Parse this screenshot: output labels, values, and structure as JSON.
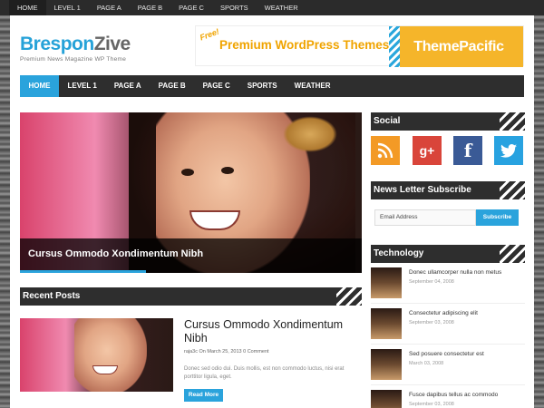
{
  "topbar": {
    "items": [
      "HOME",
      "LEVEL 1",
      "PAGE A",
      "PAGE B",
      "PAGE C",
      "SPORTS",
      "WEATHER"
    ]
  },
  "logo": {
    "title_part1": "Brespon",
    "title_part2": "Zive",
    "tagline": "Premium News Magazine WP Theme"
  },
  "ad": {
    "free": "Free!",
    "text": "Premium WordPress Themes",
    "brand": "ThemePacific"
  },
  "mainnav": {
    "items": [
      "HOME",
      "LEVEL 1",
      "PAGE A",
      "PAGE B",
      "PAGE C",
      "SPORTS",
      "WEATHER"
    ]
  },
  "hero": {
    "caption": "Cursus Ommodo Xondimentum Nibh",
    "progress": 0.37
  },
  "recent_posts": {
    "heading": "Recent Posts",
    "post": {
      "title": "Cursus Ommodo Xondimentum Nibh",
      "meta": "raja3c On March 25, 2013 0 Comment",
      "excerpt": "Donec sed odio dui. Duis mollis, est non commodo luctus, nisi erat porttitor ligula, eget.",
      "read_more": "Read More"
    }
  },
  "sidebar": {
    "social_heading": "Social",
    "social_icons": [
      "rss-icon",
      "google-plus-icon",
      "facebook-icon",
      "twitter-icon"
    ],
    "newsletter_heading": "News Letter Subscribe",
    "newsletter_placeholder": "Email Address",
    "newsletter_button": "Subscribe",
    "technology_heading": "Technology",
    "technology_items": [
      {
        "title": "Donec ullamcorper nulla non metus",
        "date": "September 04, 2008"
      },
      {
        "title": "Consectetur adipiscing elit",
        "date": "September 03, 2008"
      },
      {
        "title": "Sed posuere consectetur est",
        "date": "March 03, 2008"
      },
      {
        "title": "Fusce dapibus tellus ac commodo",
        "date": "September 03, 2008"
      }
    ]
  },
  "colors": {
    "accent": "#2aa3dc",
    "dark": "#2e2e2e",
    "rss": "#f39a26",
    "gplus": "#d9453a",
    "facebook": "#3a5a96",
    "twitter": "#28a2e0",
    "ad_orange": "#f5b52a"
  }
}
